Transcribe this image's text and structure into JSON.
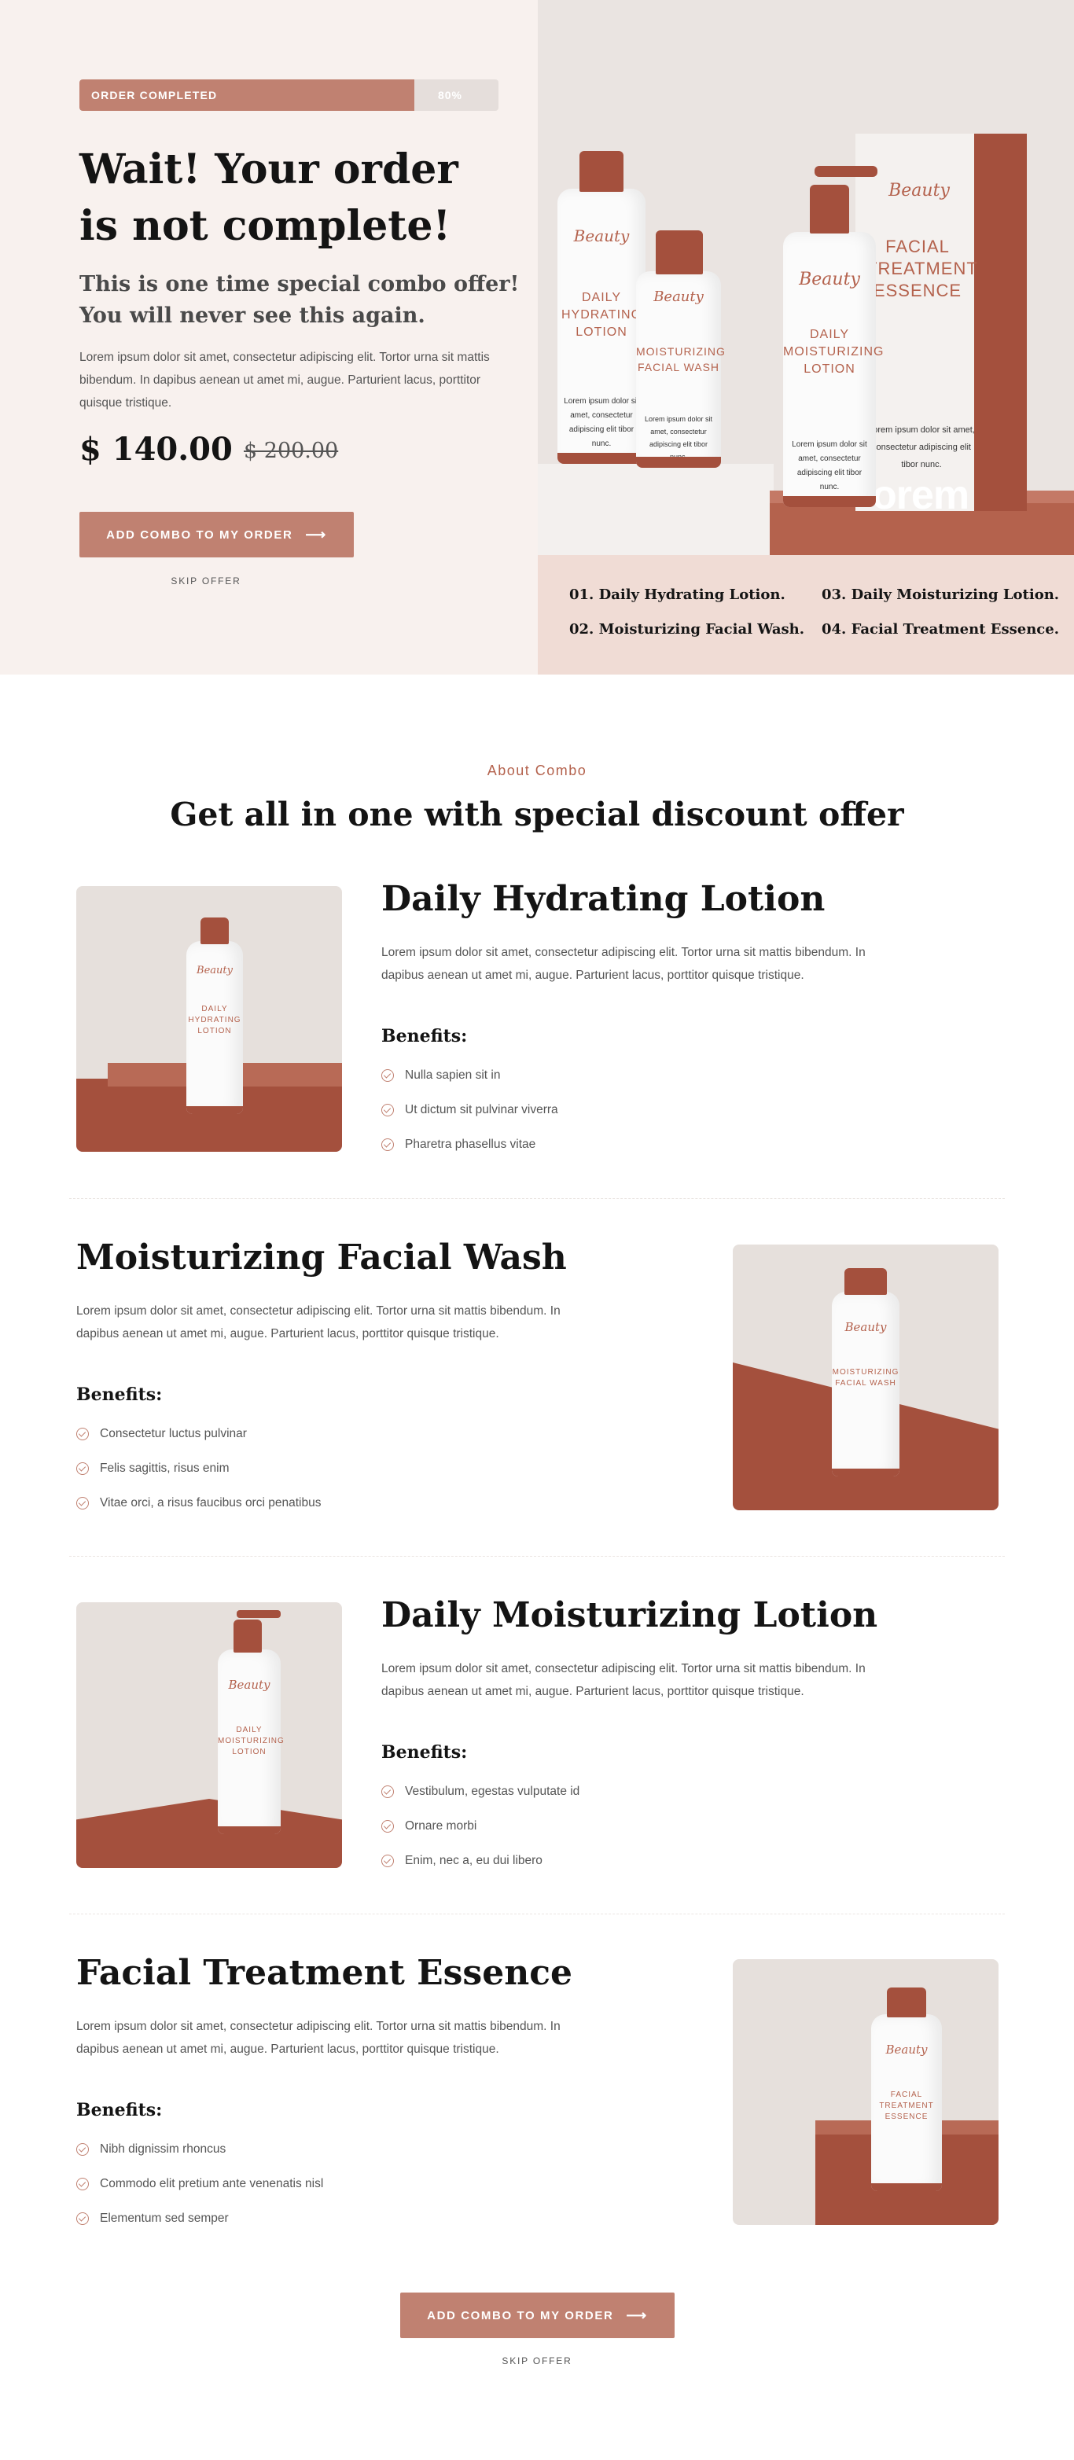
{
  "hero": {
    "progress_label": "ORDER COMPLETED",
    "progress_pct_text": "80%",
    "progress_fraction": 0.8,
    "title": "Wait! Your order is not complete!",
    "subtitle": "This is one time special combo offer! You will never see this again.",
    "description": "Lorem ipsum dolor sit amet, consectetur adipiscing elit. Tortor urna sit mattis bibendum. In dapibus aenean ut amet mi, augue. Parturient lacus, porttitor quisque tristique.",
    "price_now": "$ 140.00",
    "price_old": "$ 200.00",
    "cta_label": "ADD COMBO TO MY ORDER",
    "cta_arrow": "⟶",
    "skip_label": "SKIP OFFER",
    "list": [
      "01. Daily Hydrating Lotion.",
      "02. Moisturizing Facial Wash.",
      "03. Daily Moisturizing Lotion.",
      "04. Facial Treatment Essence."
    ],
    "photo": {
      "brand_script": "Beauty",
      "bottle1_name": "DAILY HYDRATING LOTION",
      "bottle2_name": "MOISTURIZING FACIAL WASH",
      "bottle3_name": "DAILY MOISTURIZING LOTION",
      "box_name": "FACIAL TREATMENT ESSENCE",
      "small_text": "Lorem ipsum dolor sit amet, consectetur adipiscing elit tibor nunc.",
      "lorem_big": "orem"
    }
  },
  "about": {
    "eyebrow": "About Combo",
    "title": "Get all in one with special discount offer",
    "benefits_label": "Benefits:",
    "products": [
      {
        "title": "Daily Hydrating Lotion",
        "description": "Lorem ipsum dolor sit amet, consectetur adipiscing elit. Tortor urna sit mattis bibendum. In dapibus aenean ut amet mi, augue. Parturient lacus, porttitor quisque tristique.",
        "benefits": [
          "Nulla sapien sit in",
          "Ut dictum sit pulvinar viverra",
          "Pharetra phasellus vitae"
        ],
        "bottle_name": "DAILY HYDRATING LOTION"
      },
      {
        "title": "Moisturizing Facial Wash",
        "description": "Lorem ipsum dolor sit amet, consectetur adipiscing elit. Tortor urna sit mattis bibendum. In dapibus aenean ut amet mi, augue. Parturient lacus, porttitor quisque tristique.",
        "benefits": [
          "Consectetur luctus pulvinar",
          "Felis sagittis, risus enim",
          "Vitae orci, a risus faucibus orci penatibus"
        ],
        "bottle_name": "MOISTURIZING FACIAL WASH"
      },
      {
        "title": "Daily Moisturizing Lotion",
        "description": "Lorem ipsum dolor sit amet, consectetur adipiscing elit. Tortor urna sit mattis bibendum. In dapibus aenean ut amet mi, augue. Parturient lacus, porttitor quisque tristique.",
        "benefits": [
          "Vestibulum, egestas vulputate id",
          "Ornare morbi",
          "Enim, nec a, eu dui libero"
        ],
        "bottle_name": "DAILY MOISTURIZING LOTION"
      },
      {
        "title": "Facial Treatment Essence",
        "description": "Lorem ipsum dolor sit amet, consectetur adipiscing elit. Tortor urna sit mattis bibendum. In dapibus aenean ut amet mi, augue. Parturient lacus, porttitor quisque tristique.",
        "benefits": [
          "Nibh dignissim rhoncus",
          "Commodo elit pretium ante venenatis nisl",
          "Elementum sed semper"
        ],
        "bottle_name": "FACIAL TREATMENT ESSENCE"
      }
    ]
  },
  "footer_cta": {
    "cta_label": "ADD COMBO TO MY ORDER",
    "cta_arrow": "⟶",
    "skip_label": "SKIP OFFER"
  },
  "colors": {
    "accent": "#c08171",
    "brand_brown": "#a4503d",
    "hero_bg": "#f8f1ee",
    "list_bg": "#f0dcd5"
  },
  "icons": {
    "check": "check-circle-icon",
    "arrow": "arrow-right-icon"
  }
}
